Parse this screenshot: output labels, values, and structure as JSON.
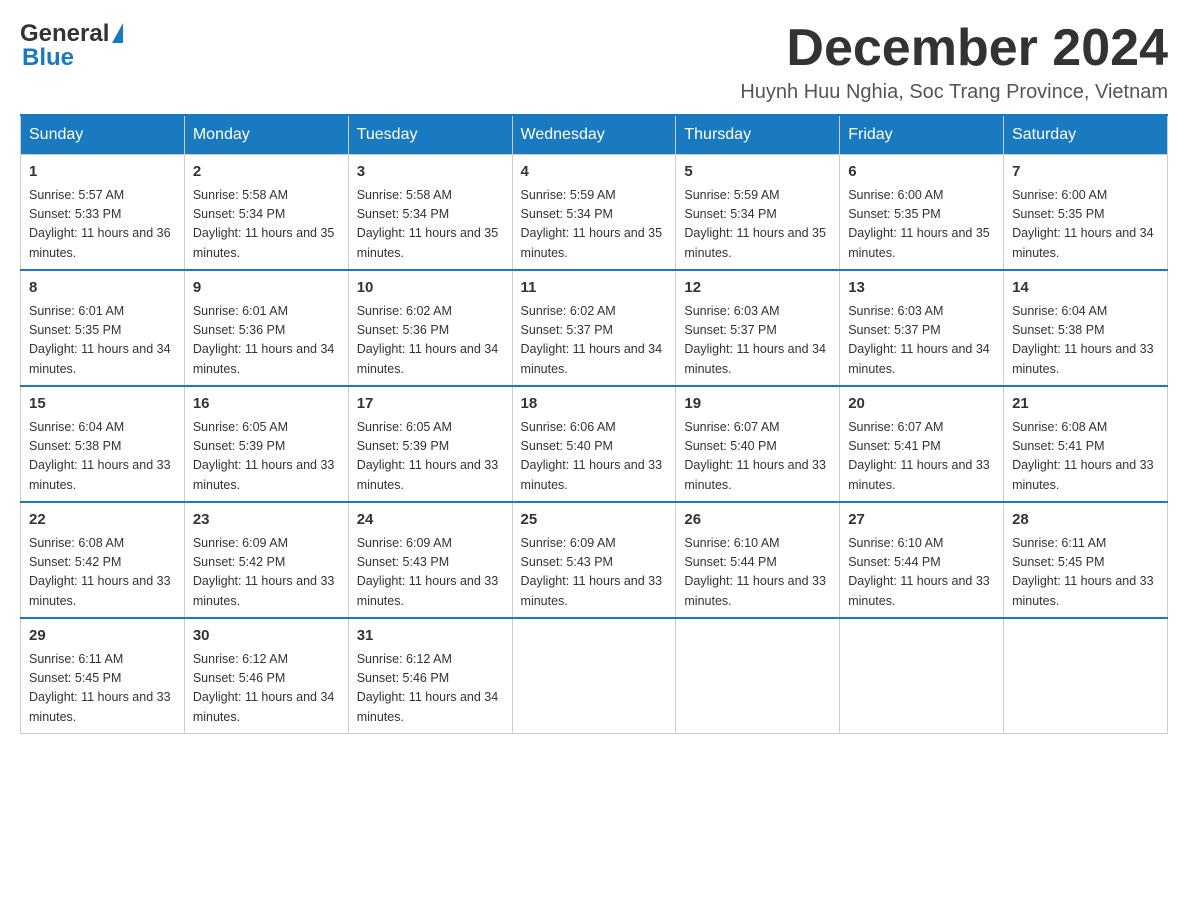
{
  "header": {
    "logo_text_general": "General",
    "logo_text_blue": "Blue",
    "title": "December 2024",
    "subtitle": "Huynh Huu Nghia, Soc Trang Province, Vietnam"
  },
  "weekdays": [
    "Sunday",
    "Monday",
    "Tuesday",
    "Wednesday",
    "Thursday",
    "Friday",
    "Saturday"
  ],
  "weeks": [
    [
      {
        "day": "1",
        "sunrise": "5:57 AM",
        "sunset": "5:33 PM",
        "daylight": "11 hours and 36 minutes."
      },
      {
        "day": "2",
        "sunrise": "5:58 AM",
        "sunset": "5:34 PM",
        "daylight": "11 hours and 35 minutes."
      },
      {
        "day": "3",
        "sunrise": "5:58 AM",
        "sunset": "5:34 PM",
        "daylight": "11 hours and 35 minutes."
      },
      {
        "day": "4",
        "sunrise": "5:59 AM",
        "sunset": "5:34 PM",
        "daylight": "11 hours and 35 minutes."
      },
      {
        "day": "5",
        "sunrise": "5:59 AM",
        "sunset": "5:34 PM",
        "daylight": "11 hours and 35 minutes."
      },
      {
        "day": "6",
        "sunrise": "6:00 AM",
        "sunset": "5:35 PM",
        "daylight": "11 hours and 35 minutes."
      },
      {
        "day": "7",
        "sunrise": "6:00 AM",
        "sunset": "5:35 PM",
        "daylight": "11 hours and 34 minutes."
      }
    ],
    [
      {
        "day": "8",
        "sunrise": "6:01 AM",
        "sunset": "5:35 PM",
        "daylight": "11 hours and 34 minutes."
      },
      {
        "day": "9",
        "sunrise": "6:01 AM",
        "sunset": "5:36 PM",
        "daylight": "11 hours and 34 minutes."
      },
      {
        "day": "10",
        "sunrise": "6:02 AM",
        "sunset": "5:36 PM",
        "daylight": "11 hours and 34 minutes."
      },
      {
        "day": "11",
        "sunrise": "6:02 AM",
        "sunset": "5:37 PM",
        "daylight": "11 hours and 34 minutes."
      },
      {
        "day": "12",
        "sunrise": "6:03 AM",
        "sunset": "5:37 PM",
        "daylight": "11 hours and 34 minutes."
      },
      {
        "day": "13",
        "sunrise": "6:03 AM",
        "sunset": "5:37 PM",
        "daylight": "11 hours and 34 minutes."
      },
      {
        "day": "14",
        "sunrise": "6:04 AM",
        "sunset": "5:38 PM",
        "daylight": "11 hours and 33 minutes."
      }
    ],
    [
      {
        "day": "15",
        "sunrise": "6:04 AM",
        "sunset": "5:38 PM",
        "daylight": "11 hours and 33 minutes."
      },
      {
        "day": "16",
        "sunrise": "6:05 AM",
        "sunset": "5:39 PM",
        "daylight": "11 hours and 33 minutes."
      },
      {
        "day": "17",
        "sunrise": "6:05 AM",
        "sunset": "5:39 PM",
        "daylight": "11 hours and 33 minutes."
      },
      {
        "day": "18",
        "sunrise": "6:06 AM",
        "sunset": "5:40 PM",
        "daylight": "11 hours and 33 minutes."
      },
      {
        "day": "19",
        "sunrise": "6:07 AM",
        "sunset": "5:40 PM",
        "daylight": "11 hours and 33 minutes."
      },
      {
        "day": "20",
        "sunrise": "6:07 AM",
        "sunset": "5:41 PM",
        "daylight": "11 hours and 33 minutes."
      },
      {
        "day": "21",
        "sunrise": "6:08 AM",
        "sunset": "5:41 PM",
        "daylight": "11 hours and 33 minutes."
      }
    ],
    [
      {
        "day": "22",
        "sunrise": "6:08 AM",
        "sunset": "5:42 PM",
        "daylight": "11 hours and 33 minutes."
      },
      {
        "day": "23",
        "sunrise": "6:09 AM",
        "sunset": "5:42 PM",
        "daylight": "11 hours and 33 minutes."
      },
      {
        "day": "24",
        "sunrise": "6:09 AM",
        "sunset": "5:43 PM",
        "daylight": "11 hours and 33 minutes."
      },
      {
        "day": "25",
        "sunrise": "6:09 AM",
        "sunset": "5:43 PM",
        "daylight": "11 hours and 33 minutes."
      },
      {
        "day": "26",
        "sunrise": "6:10 AM",
        "sunset": "5:44 PM",
        "daylight": "11 hours and 33 minutes."
      },
      {
        "day": "27",
        "sunrise": "6:10 AM",
        "sunset": "5:44 PM",
        "daylight": "11 hours and 33 minutes."
      },
      {
        "day": "28",
        "sunrise": "6:11 AM",
        "sunset": "5:45 PM",
        "daylight": "11 hours and 33 minutes."
      }
    ],
    [
      {
        "day": "29",
        "sunrise": "6:11 AM",
        "sunset": "5:45 PM",
        "daylight": "11 hours and 33 minutes."
      },
      {
        "day": "30",
        "sunrise": "6:12 AM",
        "sunset": "5:46 PM",
        "daylight": "11 hours and 34 minutes."
      },
      {
        "day": "31",
        "sunrise": "6:12 AM",
        "sunset": "5:46 PM",
        "daylight": "11 hours and 34 minutes."
      },
      null,
      null,
      null,
      null
    ]
  ]
}
